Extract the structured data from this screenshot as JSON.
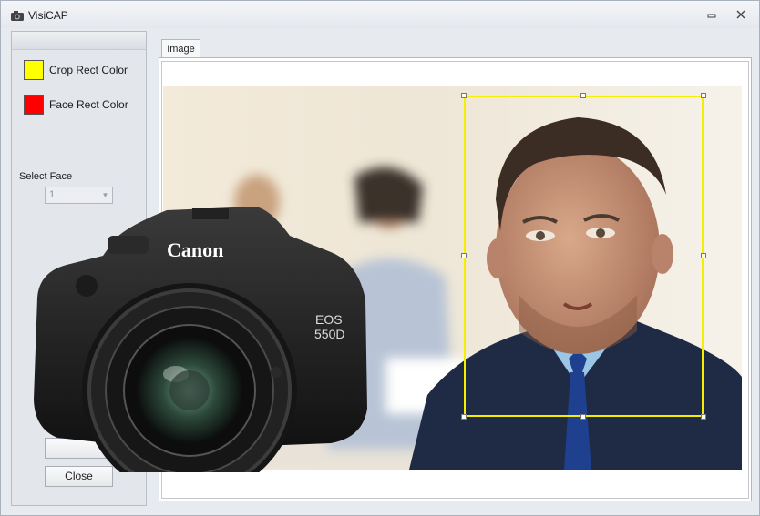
{
  "window": {
    "title": "VisiCAP",
    "app_icon": "camera-icon",
    "minimize_icon": "minimize-icon",
    "close_icon": "close-icon"
  },
  "left_panel": {
    "crop_color": {
      "label": "Crop Rect Color",
      "color": "#ffff00"
    },
    "face_color": {
      "label": "Face Rect Color",
      "color": "#ff0000"
    },
    "select_face": {
      "label": "Select Face",
      "value": "1"
    },
    "close_button": "Close"
  },
  "tabs": [
    {
      "label": "Image"
    }
  ],
  "image_view": {
    "crop_rect_color": "#f5ee00",
    "camera_brand": "Canon",
    "camera_model_line1": "EOS",
    "camera_model_line2": "550D"
  }
}
